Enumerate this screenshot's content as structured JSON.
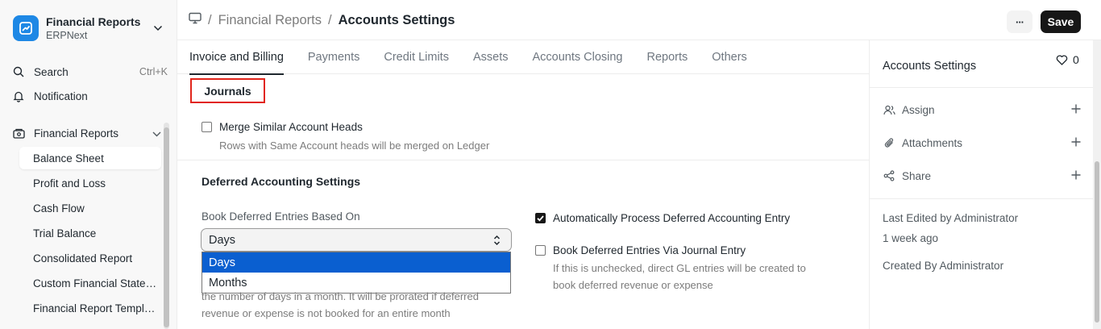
{
  "app": {
    "title": "Financial Reports",
    "subtitle": "ERPNext"
  },
  "sidebar": {
    "search_label": "Search",
    "search_shortcut": "Ctrl+K",
    "notification_label": "Notification",
    "section_label": "Financial Reports",
    "items": [
      {
        "label": "Balance Sheet"
      },
      {
        "label": "Profit and Loss"
      },
      {
        "label": "Cash Flow"
      },
      {
        "label": "Trial Balance"
      },
      {
        "label": "Consolidated Report"
      },
      {
        "label": "Custom Financial Statements"
      },
      {
        "label": "Financial Report Templates"
      }
    ]
  },
  "breadcrumb": {
    "root": "Financial Reports",
    "current": "Accounts Settings"
  },
  "toolbar": {
    "more_label": "···",
    "save_label": "Save"
  },
  "tabs": [
    {
      "label": "Invoice and Billing"
    },
    {
      "label": "Payments"
    },
    {
      "label": "Credit Limits"
    },
    {
      "label": "Assets"
    },
    {
      "label": "Accounts Closing"
    },
    {
      "label": "Reports"
    },
    {
      "label": "Others"
    }
  ],
  "main": {
    "journals_label": "Journals",
    "merge_label": "Merge Similar Account Heads",
    "merge_desc": "Rows with Same Account heads will be merged on Ledger",
    "deferred_title": "Deferred Accounting Settings",
    "book_based_label": "Book Deferred Entries Based On",
    "book_based_value": "Days",
    "options": [
      "Days",
      "Months"
    ],
    "book_based_desc_1": "the number of days in a month. It will be prorated if deferred",
    "book_based_desc_2": "revenue or expense is not booked for an entire month",
    "auto_process_label": "Automatically Process Deferred Accounting Entry",
    "via_journal_label": "Book Deferred Entries Via Journal Entry",
    "via_journal_desc_1": "If this is unchecked, direct GL entries will be created to",
    "via_journal_desc_2": "book deferred revenue or expense"
  },
  "right_panel": {
    "title": "Accounts Settings",
    "like_count": "0",
    "assign_label": "Assign",
    "attachments_label": "Attachments",
    "share_label": "Share",
    "last_edited": "Last Edited by Administrator",
    "last_edited_time": "1 week ago",
    "created_by": "Created By Administrator"
  },
  "colors": {
    "accent": "#1e88e5",
    "highlight_box": "#e1251b",
    "selected_option": "#0a5fd0",
    "primary_button": "#171717"
  }
}
